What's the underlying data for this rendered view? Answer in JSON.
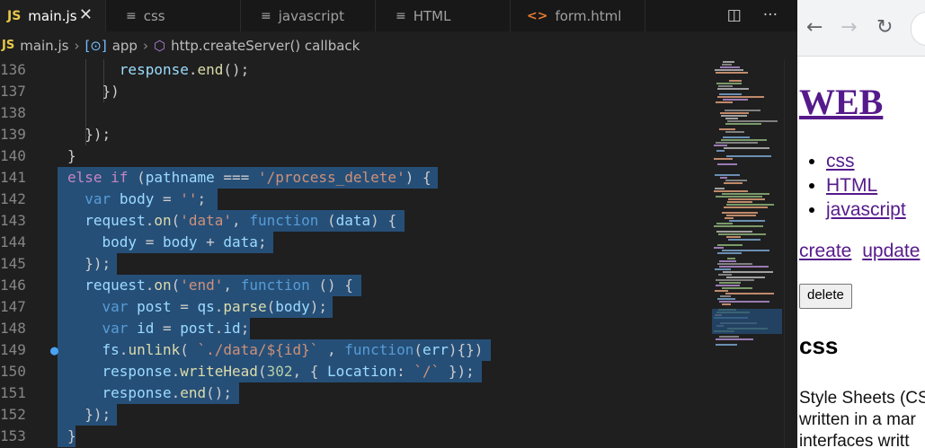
{
  "editor": {
    "tabs": [
      {
        "label": "main.js",
        "icon": "js-icon",
        "active": true
      },
      {
        "label": "css",
        "icon": "text-file-icon"
      },
      {
        "label": "javascript",
        "icon": "text-file-icon"
      },
      {
        "label": "HTML",
        "icon": "text-file-icon"
      },
      {
        "label": "form.html",
        "icon": "html-icon"
      }
    ],
    "close_glyph": "✕",
    "actions": {
      "split": "split-editor-icon",
      "more": "more-actions-icon"
    },
    "breadcrumb": {
      "badge": "JS",
      "file": "main.js",
      "scope": "app",
      "symbol": "http.createServer() callback"
    },
    "lines": [
      {
        "n": "136",
        "t": "      response.end();"
      },
      {
        "n": "137",
        "t": "    })"
      },
      {
        "n": "138",
        "t": ""
      },
      {
        "n": "139",
        "t": "  });"
      },
      {
        "n": "140",
        "t": "}"
      },
      {
        "n": "141",
        "t": "else if (pathname === '/process_delete') {"
      },
      {
        "n": "142",
        "t": "  var body = '';"
      },
      {
        "n": "143",
        "t": "  request.on('data', function (data) {"
      },
      {
        "n": "144",
        "t": "    body = body + data;"
      },
      {
        "n": "145",
        "t": "  });"
      },
      {
        "n": "146",
        "t": "  request.on('end', function () {"
      },
      {
        "n": "147",
        "t": "    var post = qs.parse(body);"
      },
      {
        "n": "148",
        "t": "    var id = post.id;"
      },
      {
        "n": "149",
        "t": "    fs.unlink( `./data/${id}` , function(err){})"
      },
      {
        "n": "150",
        "t": "    response.writeHead(302, { Location: `/` });"
      },
      {
        "n": "151",
        "t": "    response.end();"
      },
      {
        "n": "152",
        "t": "  });"
      },
      {
        "n": "153",
        "t": "}"
      }
    ]
  },
  "browser": {
    "nav": {
      "back": "←",
      "forward": "→",
      "reload": "↻"
    },
    "page": {
      "title": "WEB",
      "list": [
        "css",
        "HTML",
        "javascript"
      ],
      "links": [
        "create",
        "update"
      ],
      "delete_button": "delete",
      "heading": "css",
      "desc_line1": "Style Sheets (CS",
      "desc_line2": "written in a mar",
      "desc_line3": "interfaces writt"
    }
  }
}
